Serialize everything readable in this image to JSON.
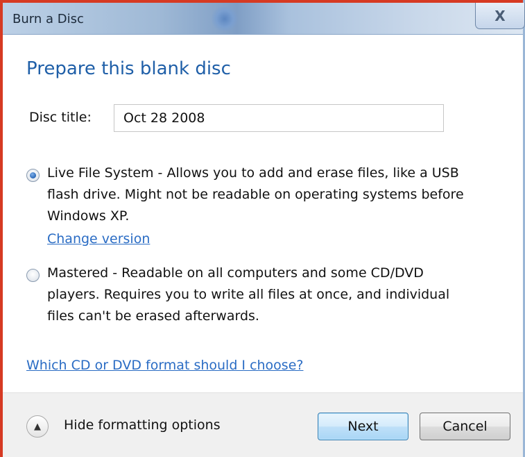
{
  "window": {
    "title": "Burn a Disc",
    "close_glyph": "X"
  },
  "main": {
    "heading": "Prepare this blank disc",
    "disc_title_label": "Disc title:",
    "disc_title_value": "Oct 28 2008",
    "options": [
      {
        "lines": [
          "Live File System - Allows you to add and erase files, like a USB",
          "flash drive. Might not be readable on operating systems before",
          "Windows XP."
        ],
        "selected": true,
        "link": "Change version"
      },
      {
        "lines": [
          "Mastered - Readable on all computers and some CD/DVD",
          "players. Requires you to write all files at once, and individual",
          "files can't be erased afterwards."
        ],
        "selected": false
      }
    ],
    "help_link": "Which CD or DVD format should I choose?"
  },
  "footer": {
    "expander_label": "Hide formatting options",
    "expander_icon": "chevron-up-icon",
    "next_label": "Next",
    "cancel_label": "Cancel"
  },
  "colors": {
    "heading": "#1f5fa8",
    "link": "#2a6cc4",
    "frame_accent": "#d63a23"
  }
}
